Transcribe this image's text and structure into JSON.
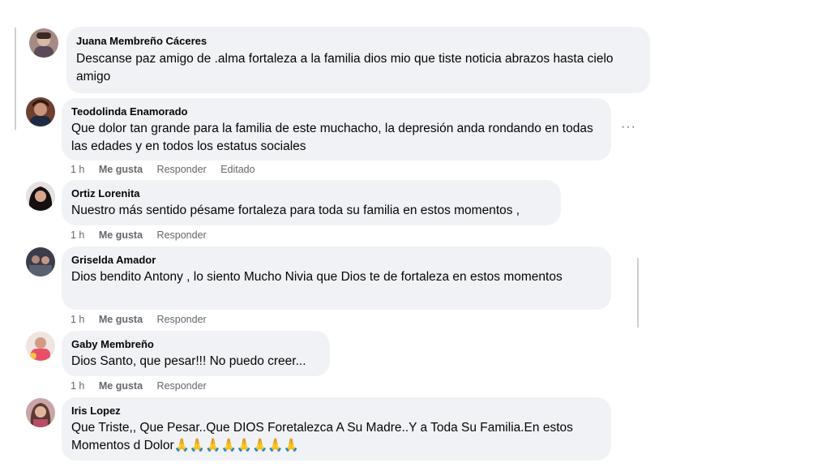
{
  "colors": {
    "bubble": "#f0f2f5",
    "meta_text": "#65676b",
    "thread_line": "#ced0d4"
  },
  "comments": [
    {
      "author": "Juana Membreño Cáceres",
      "text": "Descanse paz amigo de .alma fortaleza a la familia dios mio que tiste noticia abrazos hasta cielo amigo",
      "avatar_icon": "avatar-photo"
    },
    {
      "author": "Teodolinda Enamorado",
      "text": "Que dolor tan grande para la familia de este muchacho, la depresión anda rondando en todas las edades y en todos los estatus sociales",
      "time": "1 h",
      "like": "Me gusta",
      "reply": "Responder",
      "edited": "Editado",
      "more": "···",
      "avatar_icon": "avatar-photo"
    },
    {
      "author": "Ortiz Lorenita",
      "text": "Nuestro más sentido pésame fortaleza para toda su familia en estos momentos ,",
      "time": "1 h",
      "like": "Me gusta",
      "reply": "Responder",
      "avatar_icon": "avatar-photo"
    },
    {
      "author": "Griselda Amador",
      "text": "Dios bendito Antony , lo siento Mucho Nivia que Dios te de fortaleza en estos momentos",
      "time": "1 h",
      "like": "Me gusta",
      "reply": "Responder",
      "avatar_icon": "avatar-photo"
    },
    {
      "author": "Gaby Membreño",
      "text": "Dios Santo, que pesar!!! No puedo creer...",
      "time": "1 h",
      "like": "Me gusta",
      "reply": "Responder",
      "avatar_icon": "avatar-photo"
    },
    {
      "author": "Iris Lopez",
      "text": "Que Triste,, Que Pesar..Que DIOS Foretalezca A Su Madre..Y a Toda Su Familia.En estos Momentos d Dolor🙏🙏🙏🙏🙏🙏🙏🙏",
      "avatar_icon": "avatar-photo"
    }
  ]
}
